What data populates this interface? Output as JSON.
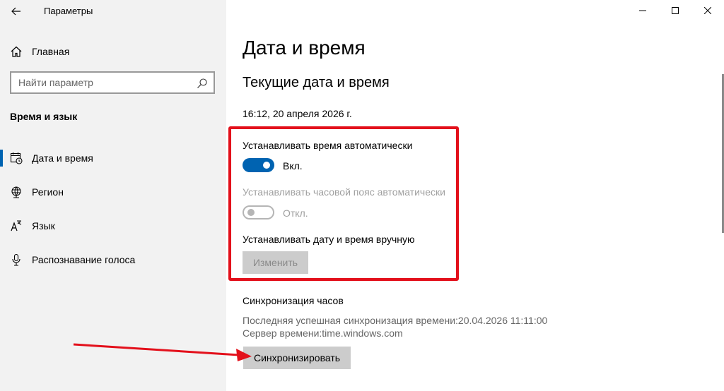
{
  "window": {
    "title": "Параметры",
    "controls": [
      "minimize-icon",
      "maximize-icon",
      "close-icon"
    ]
  },
  "sidebar": {
    "home_label": "Главная",
    "search_placeholder": "Найти параметр",
    "section_title": "Время и язык",
    "items": [
      {
        "label": "Дата и время",
        "icon": "calendar-clock-icon",
        "active": true
      },
      {
        "label": "Регион",
        "icon": "globe-icon",
        "active": false
      },
      {
        "label": "Язык",
        "icon": "language-icon",
        "active": false
      },
      {
        "label": "Распознавание голоса",
        "icon": "microphone-icon",
        "active": false
      }
    ]
  },
  "main": {
    "page_title": "Дата и время",
    "subtitle": "Текущие дата и время",
    "current_datetime": "16:12, 20 апреля 2026 г.",
    "auto_time": {
      "label": "Устанавливать время автоматически",
      "state": "Вкл.",
      "on": true
    },
    "auto_timezone": {
      "label": "Устанавливать часовой пояс автоматически",
      "state": "Откл.",
      "on": false,
      "disabled": true
    },
    "manual": {
      "label": "Устанавливать дату и время вручную",
      "button": "Изменить"
    },
    "sync": {
      "title": "Синхронизация часов",
      "last_sync": "Последняя успешная синхронизация времени:20.04.2026 11:11:00",
      "server": "Сервер времени:time.windows.com",
      "button": "Синхронизировать"
    }
  },
  "colors": {
    "accent": "#0063b1",
    "highlight": "#e3101b",
    "sidebar_bg": "#f2f2f2"
  }
}
